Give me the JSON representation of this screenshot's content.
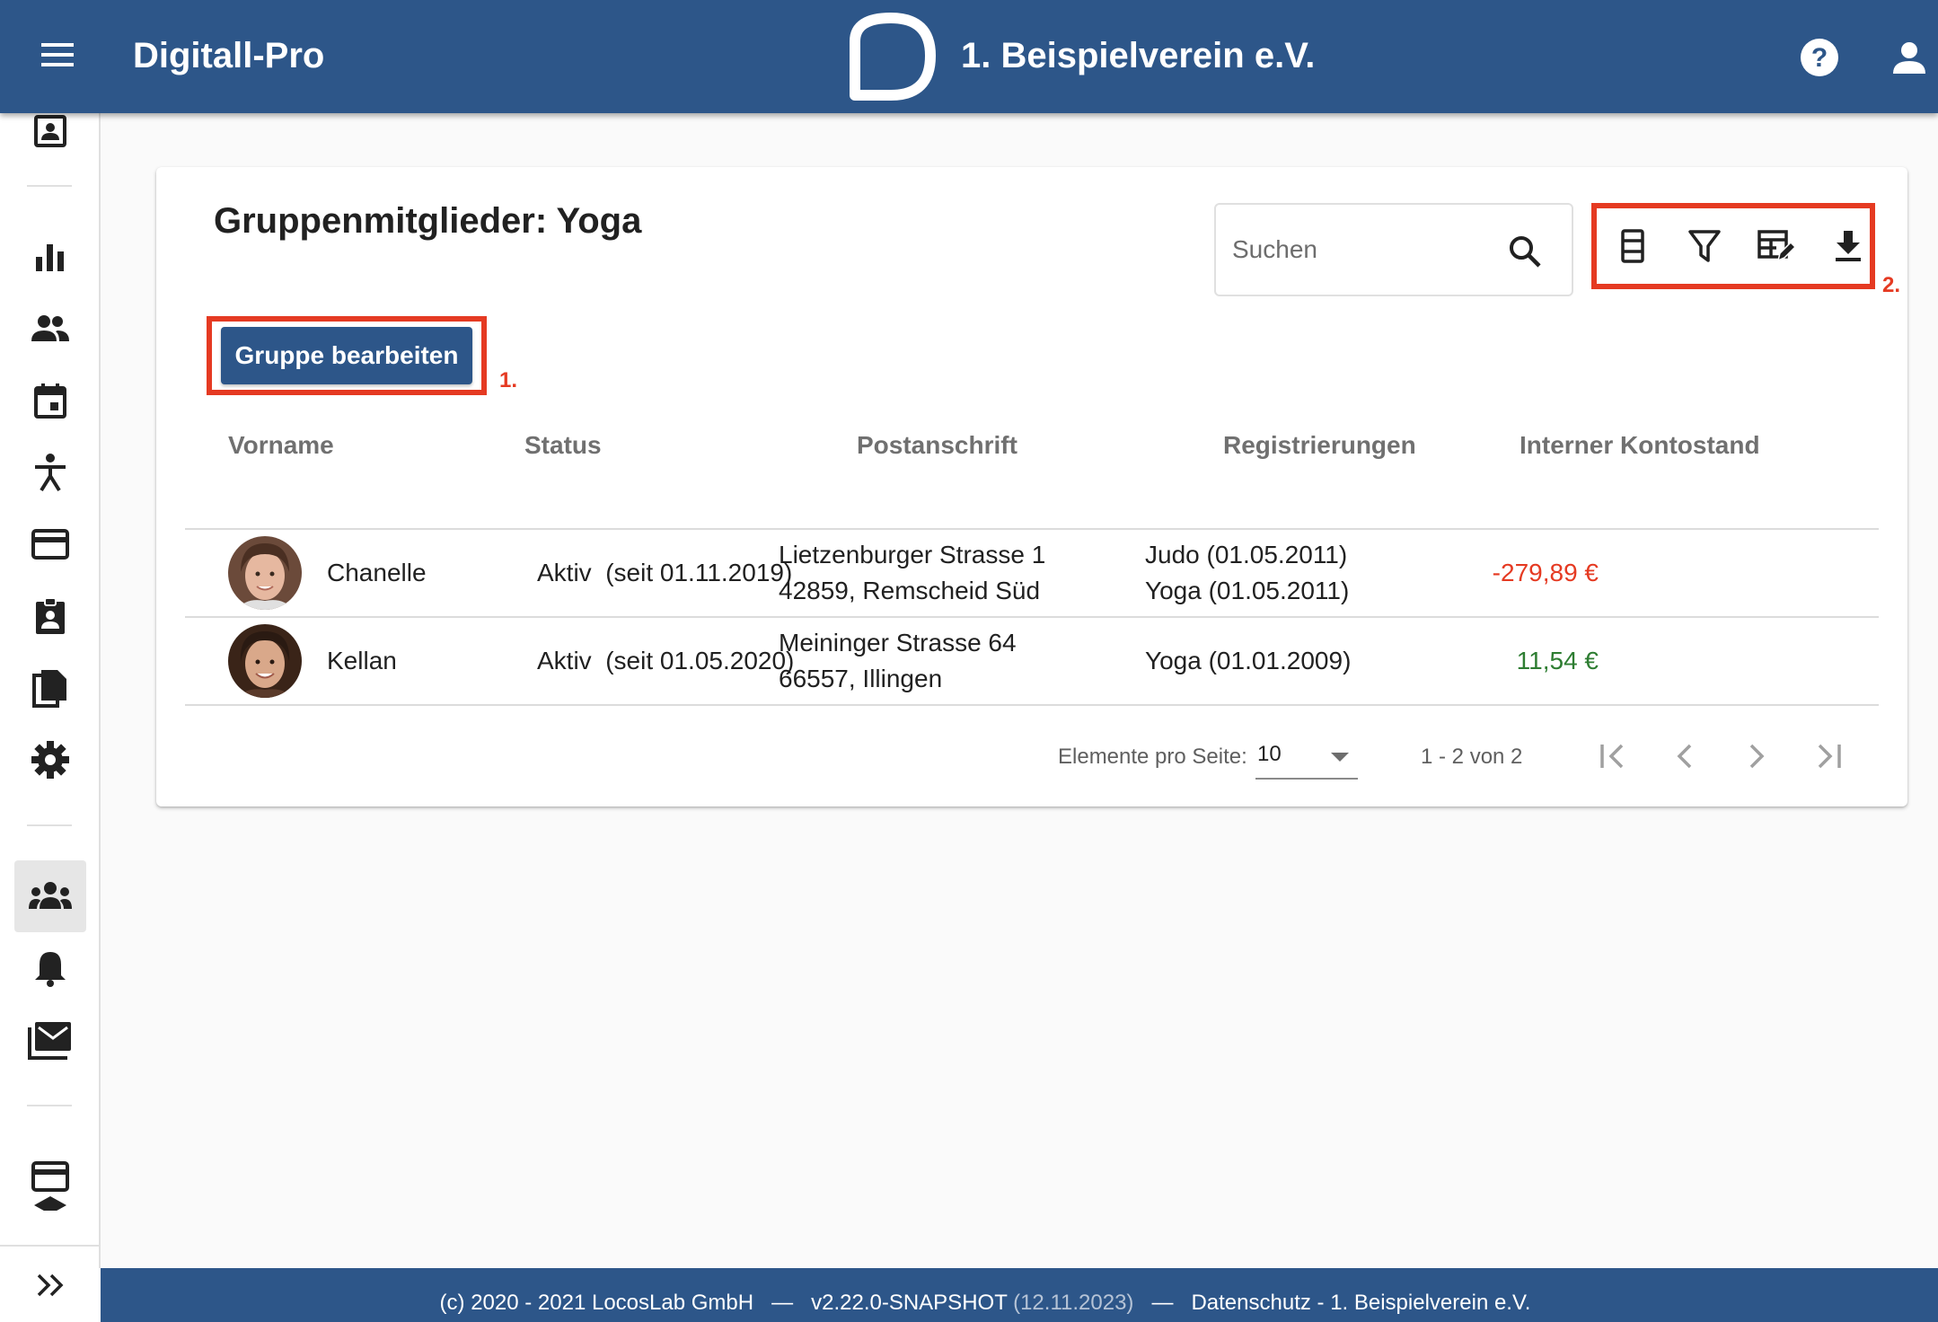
{
  "header": {
    "app_title": "Digitall-Pro",
    "club_name": "1. Beispielverein e.V.",
    "menu_icon": "hamburger-menu-icon",
    "help_icon": "help-circle-icon",
    "user_icon": "account-icon"
  },
  "sidebar": {
    "items": [
      {
        "icon": "contact-card-icon"
      },
      {
        "icon": "bar-chart-icon"
      },
      {
        "icon": "people-icon"
      },
      {
        "icon": "calendar-icon"
      },
      {
        "icon": "exercise-figure-icon"
      },
      {
        "icon": "credit-card-icon"
      },
      {
        "icon": "badge-icon"
      },
      {
        "icon": "documents-icon"
      },
      {
        "icon": "settings-gear-icon"
      },
      {
        "icon": "groups-icon",
        "active": true
      },
      {
        "icon": "bell-icon"
      },
      {
        "icon": "mail-stack-icon"
      },
      {
        "icon": "credit-card-icon"
      },
      {
        "icon": "expand-chevrons-icon"
      }
    ]
  },
  "card": {
    "title": "Gruppenmitglieder: Yoga",
    "search_placeholder": "Suchen",
    "edit_button_label": "Gruppe bearbeiten",
    "annotation_1": "1.",
    "annotation_2": "2.",
    "toolbar_icons": [
      "columns-icon",
      "filter-icon",
      "table-edit-icon",
      "download-icon"
    ]
  },
  "table": {
    "headers": [
      "Vorname",
      "Status",
      "Postanschrift",
      "Registrierungen",
      "Interner Kontostand"
    ],
    "rows": [
      {
        "vorname": "Chanelle",
        "status": "Aktiv  (seit 01.11.2019)",
        "address_line1": "Lietzenburger Strasse 1",
        "address_line2": "42859, Remscheid Süd",
        "reg_line1": "Judo (01.05.2011)",
        "reg_line2": "Yoga (01.05.2011)",
        "balance": "-279,89 €"
      },
      {
        "vorname": "Kellan",
        "status": "Aktiv  (seit 01.05.2020)",
        "address_line1": "Meininger Strasse 64",
        "address_line2": "66557, Illingen",
        "reg_line1": "Yoga (01.01.2009)",
        "balance": "11,54 €"
      }
    ]
  },
  "paginator": {
    "items_per_page_label": "Elemente pro Seite:",
    "items_per_page_value": "10",
    "range_label": "1 - 2 von 2"
  },
  "footer": {
    "copyright": "(c) 2020 - 2021 LocosLab GmbH",
    "separator": "—",
    "version": "v2.22.0-SNAPSHOT",
    "version_date": "(12.11.2023)",
    "privacy": "Datenschutz - 1. Beispielverein e.V."
  },
  "colors": {
    "primary": "#2d5689",
    "annotation_red": "#e53a22",
    "negative": "#e53a22",
    "positive": "#2e7d32"
  }
}
